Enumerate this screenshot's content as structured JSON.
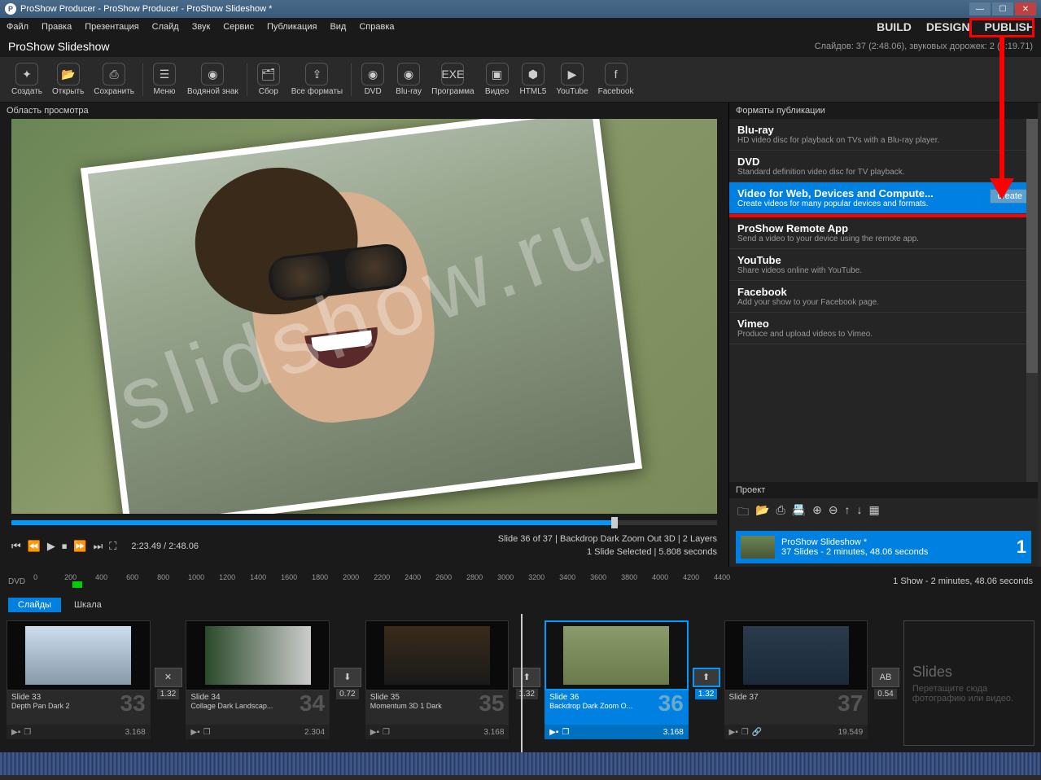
{
  "titlebar": "ProShow Producer - ProShow Producer - ProShow Slideshow *",
  "menu": [
    "Файл",
    "Правка",
    "Презентация",
    "Слайд",
    "Звук",
    "Сервис",
    "Публикация",
    "Вид",
    "Справка"
  ],
  "modes": {
    "build": "BUILD",
    "design": "DESIGN",
    "publish": "PUBLISH"
  },
  "subtitle": {
    "name": "ProShow Slideshow",
    "stats": "Слайдов: 37 (2:48.06), звуковых дорожек: 2 (3:19.71)"
  },
  "toolbar": [
    {
      "label": "Создать",
      "icon": "✦"
    },
    {
      "label": "Открыть",
      "icon": "📂"
    },
    {
      "label": "Сохранить",
      "icon": "⎙"
    },
    {
      "label": "Меню",
      "icon": "☰"
    },
    {
      "label": "Водяной знак",
      "icon": "◉"
    },
    {
      "label": "Сбор",
      "icon": "🗂"
    },
    {
      "label": "Все форматы",
      "icon": "⇪"
    },
    {
      "label": "DVD",
      "icon": "◉"
    },
    {
      "label": "Blu-ray",
      "icon": "◉"
    },
    {
      "label": "Программа",
      "icon": "EXE"
    },
    {
      "label": "Видео",
      "icon": "▣"
    },
    {
      "label": "HTML5",
      "icon": "⬢"
    },
    {
      "label": "YouTube",
      "icon": "▶"
    },
    {
      "label": "Facebook",
      "icon": "f"
    }
  ],
  "preview": {
    "label": "Область просмотра",
    "time": "2:23.49 / 2:48.06",
    "slide_info": "Slide 36 of 37  |  Backdrop Dark Zoom Out 3D  |  2 Layers",
    "selection": "1 Slide Selected  |  5.808 seconds"
  },
  "watermark": "slidshow.ru",
  "side": {
    "header": "Форматы публикации",
    "formats": [
      {
        "title": "Blu-ray",
        "desc": "HD video disc for playback on TVs with a Blu-ray player."
      },
      {
        "title": "DVD",
        "desc": "Standard definition video disc for TV playback."
      },
      {
        "title": "Video for Web, Devices and Compute...",
        "desc": "Create videos for many popular devices and formats.",
        "selected": true,
        "create": "create"
      },
      {
        "title": "ProShow Remote App",
        "desc": "Send a video to your device using the remote app."
      },
      {
        "title": "YouTube",
        "desc": "Share videos online with YouTube."
      },
      {
        "title": "Facebook",
        "desc": "Add your show to your Facebook page."
      },
      {
        "title": "Vimeo",
        "desc": "Produce and upload videos to Vimeo."
      }
    ],
    "project_header": "Проект",
    "project": {
      "name": "ProShow Slideshow *",
      "detail": "37 Slides - 2 minutes, 48.06 seconds",
      "num": "1"
    }
  },
  "ruler": {
    "label": "DVD",
    "ticks": [
      "0",
      "200",
      "400",
      "600",
      "800",
      "1000",
      "1200",
      "1400",
      "1600",
      "1800",
      "2000",
      "2200",
      "2400",
      "2600",
      "2800",
      "3000",
      "3200",
      "3400",
      "3600",
      "3800",
      "4000",
      "4200",
      "4400"
    ],
    "summary": "1 Show - 2 minutes, 48.06 seconds"
  },
  "tabs": {
    "slides": "Слайды",
    "scale": "Шкала"
  },
  "slides": [
    {
      "num": "33",
      "big": "33",
      "title": "Slide 33",
      "style": "Depth Pan Dark 2",
      "dur": "3.168",
      "trans": "1.32",
      "bg": "linear-gradient(#cde,#89a)"
    },
    {
      "num": "34",
      "big": "34",
      "title": "Slide 34",
      "style": "Collage Dark Landscap...",
      "dur": "2.304",
      "trans": "0.72",
      "bg": "linear-gradient(90deg,#2a4a2a,#ccc)"
    },
    {
      "num": "35",
      "big": "35",
      "title": "Slide 35",
      "style": "Momentum 3D 1 Dark",
      "dur": "3.168",
      "trans": "1.32",
      "bg": "linear-gradient(#3a2a1a,#1a1a1a)"
    },
    {
      "num": "36",
      "big": "36",
      "title": "Slide 36",
      "style": "Backdrop Dark Zoom O...",
      "dur": "3.168",
      "trans": "1.32",
      "selected": true,
      "bg": "linear-gradient(#8a9a6a,#6a7a4a)"
    },
    {
      "num": "37",
      "big": "37",
      "title": "Slide 37",
      "style": "",
      "dur": "19.549",
      "trans": "0.54",
      "bg": "linear-gradient(#2a3a4a,#1a2a3a)"
    }
  ],
  "placeholder": {
    "title": "Slides",
    "line1": "Перетащите сюда",
    "line2": "фотографию или видео."
  }
}
